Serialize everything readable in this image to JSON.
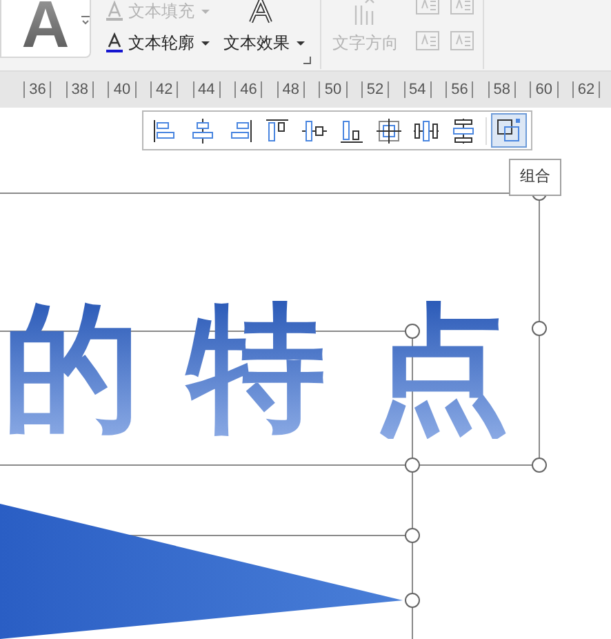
{
  "ribbon": {
    "preview_glyph": "A",
    "buttons": [
      {
        "label": "文本填充",
        "kind": "fill",
        "disabled": true,
        "dropdown": true
      },
      {
        "label": "文本轮廓",
        "kind": "outline",
        "disabled": false,
        "dropdown": true
      },
      {
        "label": "文本效果",
        "kind": "effect",
        "disabled": false,
        "dropdown": true
      },
      {
        "label": "文字方向",
        "kind": "direction",
        "disabled": true,
        "dropdown": false
      }
    ]
  },
  "ruler": {
    "ticks": [
      "36",
      "38",
      "40",
      "42",
      "44",
      "46",
      "48",
      "50",
      "52",
      "54",
      "56",
      "58",
      "60",
      "62"
    ]
  },
  "align_toolbar": {
    "buttons": [
      {
        "kind": "align-left",
        "selected": false
      },
      {
        "kind": "align-center",
        "selected": false
      },
      {
        "kind": "align-right",
        "selected": false
      },
      {
        "kind": "align-top",
        "selected": false
      },
      {
        "kind": "align-middle",
        "selected": false
      },
      {
        "kind": "align-bottom",
        "selected": false
      },
      {
        "kind": "center",
        "selected": false
      },
      {
        "kind": "distribute-h",
        "selected": false
      },
      {
        "kind": "distribute-v",
        "selected": false
      },
      {
        "kind": "group",
        "selected": true
      }
    ]
  },
  "tooltip": "组合",
  "slide": {
    "title_text": "的特点"
  }
}
